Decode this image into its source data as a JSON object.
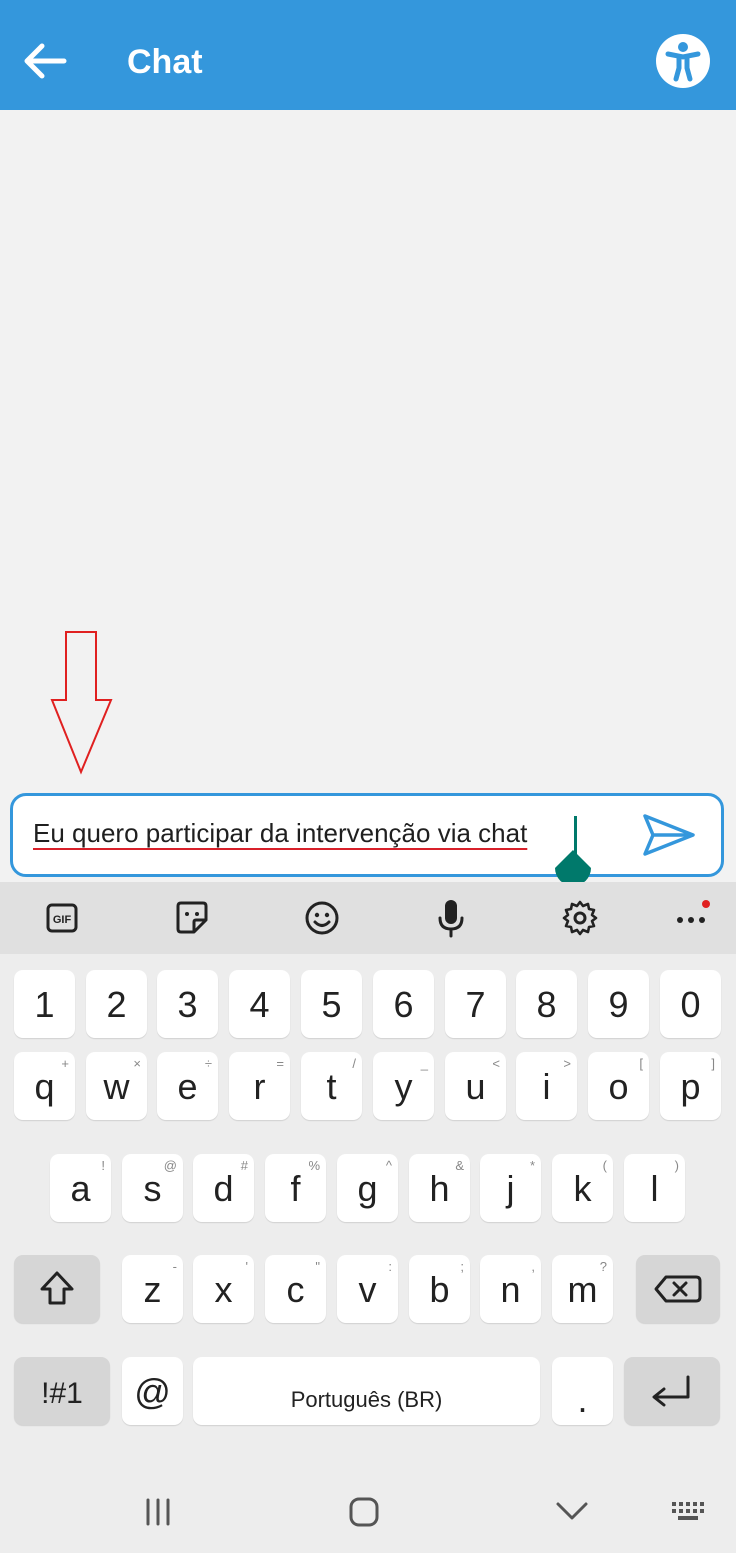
{
  "header": {
    "title": "Chat",
    "back_icon": "arrow-left-icon",
    "accessibility_icon": "accessibility-icon",
    "background": "#3497dc"
  },
  "chat": {
    "messages": [],
    "annotation": "red-down-arrow"
  },
  "composer": {
    "text": "Eu quero participar da intervenção via chat",
    "send_icon": "send-icon",
    "border_color": "#3497dc"
  },
  "keyboard": {
    "toolbar": [
      "gif-icon",
      "sticker-icon",
      "emoji-icon",
      "microphone-icon",
      "settings-icon",
      "more-icon"
    ],
    "number_row": [
      "1",
      "2",
      "3",
      "4",
      "5",
      "6",
      "7",
      "8",
      "9",
      "0"
    ],
    "row1": {
      "keys": [
        "q",
        "w",
        "e",
        "r",
        "t",
        "y",
        "u",
        "i",
        "o",
        "p"
      ],
      "hints": [
        "+",
        "×",
        "÷",
        "=",
        "/",
        "_",
        "<",
        ">",
        "[",
        "]"
      ]
    },
    "row2": {
      "keys": [
        "a",
        "s",
        "d",
        "f",
        "g",
        "h",
        "j",
        "k",
        "l"
      ],
      "hints": [
        "!",
        "@",
        "#",
        "%",
        "^",
        "&",
        "*",
        "(",
        ")"
      ]
    },
    "row3": {
      "keys": [
        "z",
        "x",
        "c",
        "v",
        "b",
        "n",
        "m"
      ],
      "hints": [
        "-",
        "'",
        "\"",
        ":",
        ";",
        ",",
        "?"
      ]
    },
    "bottom": {
      "symbols_label": "!#1",
      "at_label": "@",
      "space_label": "Português (BR)",
      "period_label": "."
    }
  },
  "navbar": [
    "recents-icon",
    "home-icon",
    "back-chevron-icon",
    "keyboard-hide-icon"
  ]
}
